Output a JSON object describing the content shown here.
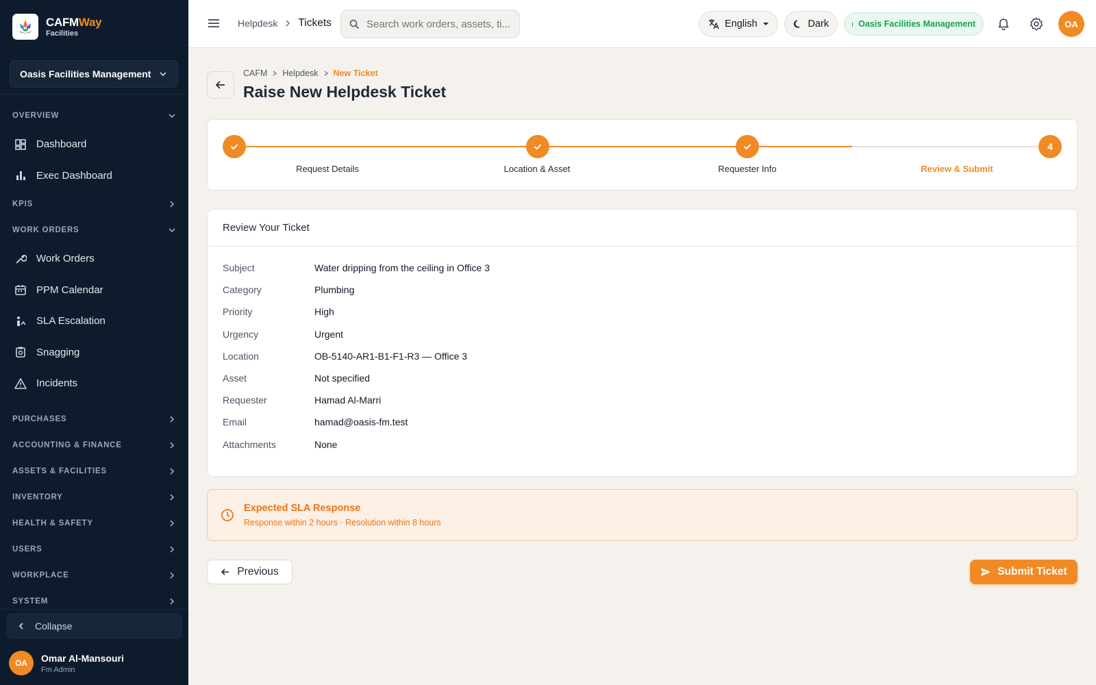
{
  "brand": {
    "name_part1": "CAFM",
    "name_part2": "Way",
    "subtitle": "Facilities"
  },
  "sidebar": {
    "org_selector": "Oasis Facilities Management",
    "sections": {
      "overview": "OVERVIEW",
      "kpis": "KPIS",
      "work_orders": "WORK ORDERS",
      "purchases": "PURCHASES",
      "accounting": "ACCOUNTING & FINANCE",
      "assets": "ASSETS & FACILITIES",
      "inventory": "INVENTORY",
      "health": "HEALTH & SAFETY",
      "users": "USERS",
      "workplace": "WORKPLACE",
      "system": "SYSTEM"
    },
    "items": {
      "dashboard": "Dashboard",
      "exec_dashboard": "Exec Dashboard",
      "work_orders": "Work Orders",
      "ppm_calendar": "PPM Calendar",
      "sla_escalation": "SLA Escalation",
      "snagging": "Snagging",
      "incidents": "Incidents"
    },
    "collapse_label": "Collapse",
    "user": {
      "initials": "OA",
      "name": "Omar Al-Mansouri",
      "role": "Fm Admin"
    }
  },
  "topbar": {
    "breadcrumb_parent": "Helpdesk",
    "breadcrumb_current": "Tickets",
    "search_placeholder": "Search work orders, assets, ti...",
    "language": "English",
    "theme_label": "Dark",
    "org_badge": "Oasis Facilities Management",
    "avatar_initials": "OA"
  },
  "page": {
    "breadcrumb": [
      "CAFM",
      "Helpdesk",
      "New Ticket"
    ],
    "title": "Raise New Helpdesk Ticket"
  },
  "stepper": {
    "steps": [
      "Request Details",
      "Location & Asset",
      "Requester Info",
      "Review & Submit"
    ],
    "current_step": "4"
  },
  "review": {
    "title": "Review Your Ticket",
    "fields": [
      {
        "label": "Subject",
        "value": "Water dripping from the ceiling in Office 3"
      },
      {
        "label": "Category",
        "value": "Plumbing"
      },
      {
        "label": "Priority",
        "value": "High"
      },
      {
        "label": "Urgency",
        "value": "Urgent"
      },
      {
        "label": "Location",
        "value": "OB-5140-AR1-B1-F1-R3 — Office 3"
      },
      {
        "label": "Asset",
        "value": "Not specified"
      },
      {
        "label": "Requester",
        "value": "Hamad Al-Marri"
      },
      {
        "label": "Email",
        "value": "hamad@oasis-fm.test"
      },
      {
        "label": "Attachments",
        "value": "None"
      }
    ]
  },
  "sla": {
    "title": "Expected SLA Response",
    "detail": "Response within 2 hours · Resolution within 8 hours"
  },
  "actions": {
    "previous": "Previous",
    "submit": "Submit Ticket"
  },
  "colors": {
    "accent": "#f08a24",
    "sidebar_bg": "#0e1b2c",
    "success": "#16a34a"
  }
}
